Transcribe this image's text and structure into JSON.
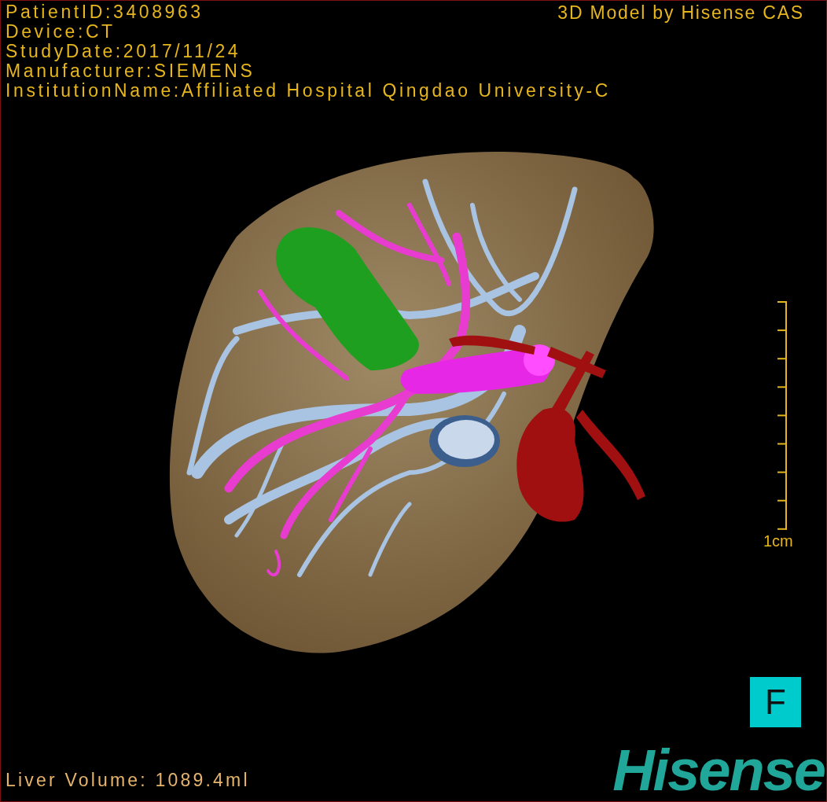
{
  "info_lines": [
    "PatientID:3408963",
    "Device:CT",
    "StudyDate:2017/11/24",
    "Manufacturer:SIEMENS",
    "InstitutionName:Affiliated Hospital Qingdao University-C"
  ],
  "caption": "3D Model by Hisense CAS",
  "scale": {
    "label": "1cm"
  },
  "orientation": {
    "label": "F"
  },
  "logo": "Hisense",
  "volume": "Liver Volume: 1089.4ml"
}
